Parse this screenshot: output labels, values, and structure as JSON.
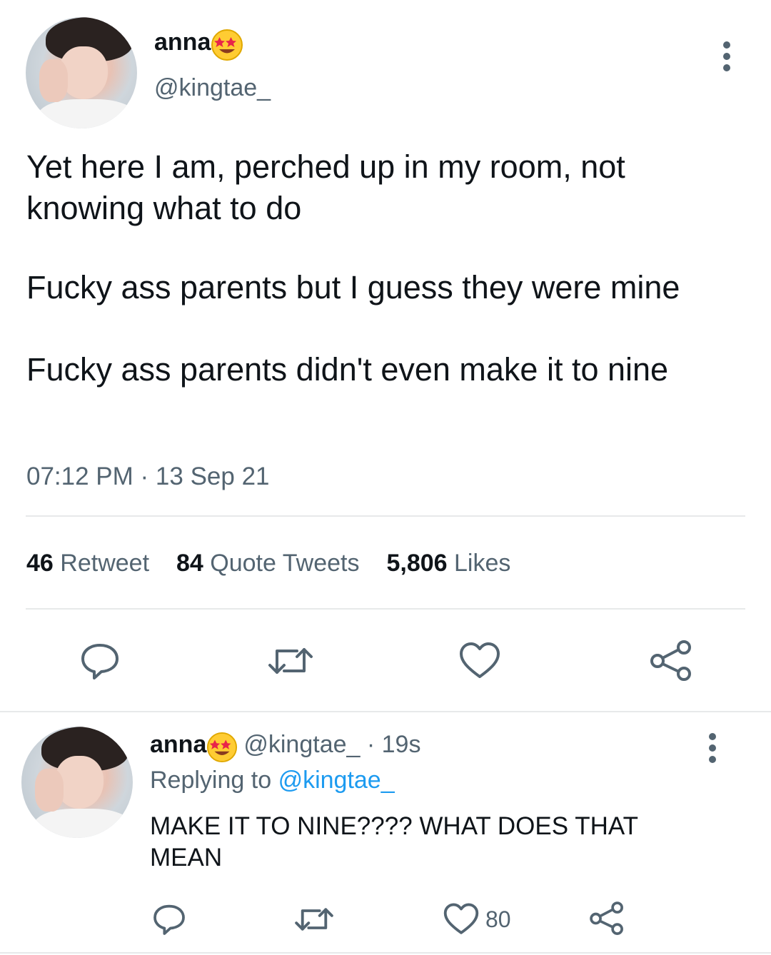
{
  "tweet": {
    "author_name": "anna",
    "author_emoji": "star-struck-emoji",
    "author_handle": "@kingtae_",
    "paragraphs": [
      "Yet here I am, perched up in my room, not knowing what to do",
      "Fucky ass parents but I guess they were mine",
      "Fucky ass parents didn't even make it to nine"
    ],
    "timestamp": "07:12 PM · 13 Sep 21",
    "stats": {
      "retweets_count": "46",
      "retweets_label": "Retweet",
      "quotes_count": "84",
      "quotes_label": "Quote Tweets",
      "likes_count": "5,806",
      "likes_label": "Likes"
    },
    "actions": [
      "reply-icon",
      "retweet-icon",
      "like-icon",
      "share-icon"
    ]
  },
  "reply": {
    "author_name": "anna",
    "author_emoji": "star-struck-emoji",
    "author_handle": "@kingtae_",
    "separator": " · ",
    "age": "19s",
    "replying_prefix": "Replying to",
    "replying_to": "@kingtae_",
    "text": "MAKE IT TO NINE???? WHAT DOES THAT MEAN",
    "like_count": "80"
  },
  "colors": {
    "text": "#0f1419",
    "secondary": "#536471",
    "link": "#1d9bf0",
    "divider": "#e7e9ea"
  }
}
